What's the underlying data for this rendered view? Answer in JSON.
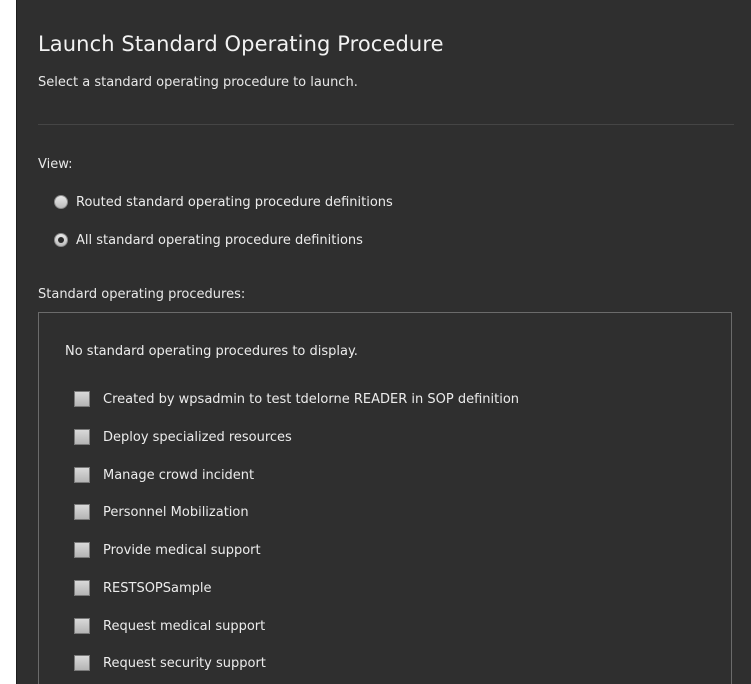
{
  "dialog": {
    "title": "Launch Standard Operating Procedure",
    "subtitle": "Select a standard operating procedure to launch."
  },
  "view": {
    "label": "View:",
    "options": [
      {
        "label": "Routed standard operating procedure definitions",
        "selected": false
      },
      {
        "label": "All standard operating procedure definitions",
        "selected": true
      }
    ]
  },
  "procedures": {
    "label": "Standard operating procedures:",
    "empty_message": "No standard operating procedures to display.",
    "items": [
      {
        "label": "Created by wpsadmin to test tdelorne READER in SOP definition",
        "checked": false
      },
      {
        "label": "Deploy specialized resources",
        "checked": false
      },
      {
        "label": "Manage crowd incident",
        "checked": false
      },
      {
        "label": "Personnel Mobilization",
        "checked": false
      },
      {
        "label": "Provide medical support",
        "checked": false
      },
      {
        "label": "RESTSOPSample",
        "checked": false
      },
      {
        "label": "Request medical support",
        "checked": false
      },
      {
        "label": "Request security support",
        "checked": false
      }
    ]
  },
  "colors": {
    "panel_background": "#2f2f2f",
    "text": "#ececec",
    "border": "#6b6b6b"
  }
}
